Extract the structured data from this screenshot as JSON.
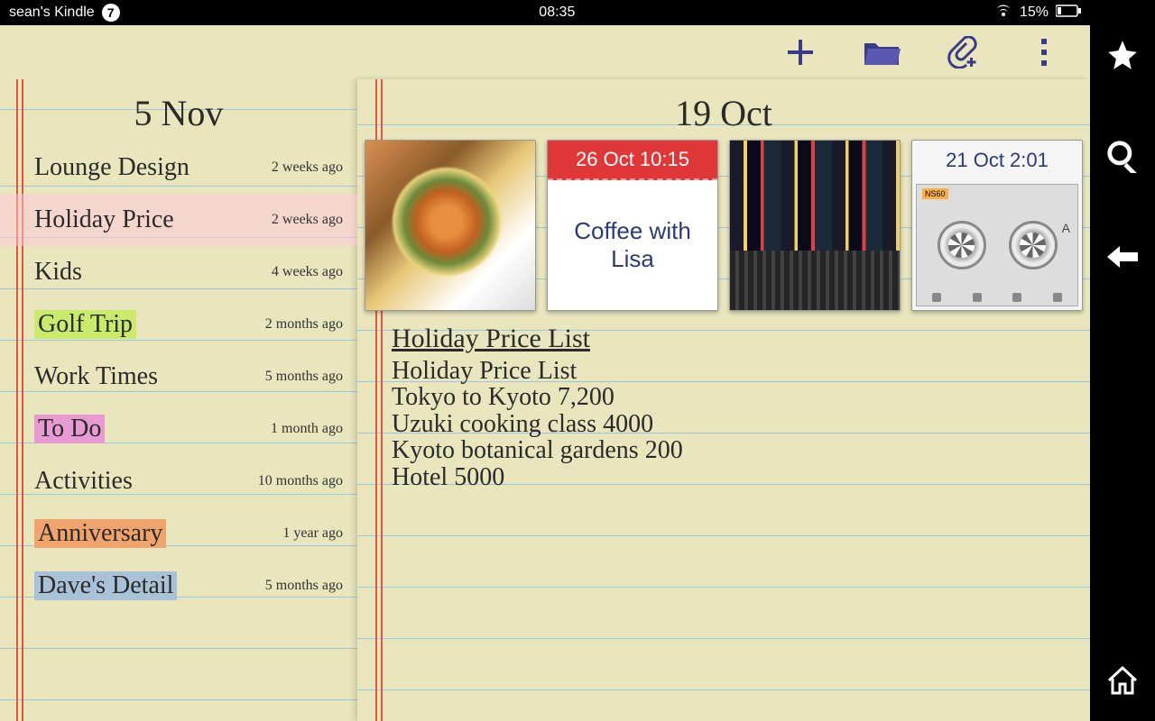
{
  "status": {
    "device": "sean's Kindle",
    "badge": "7",
    "time": "08:35",
    "battery_pct": "15%"
  },
  "sidebar": {
    "date": "5 Nov",
    "items": [
      {
        "title": "Lounge Design",
        "time": "2 weeks ago",
        "highlight": "",
        "selected": false
      },
      {
        "title": "Holiday Price",
        "time": "2 weeks ago",
        "highlight": "",
        "selected": true
      },
      {
        "title": "Kids",
        "time": "4 weeks ago",
        "highlight": "",
        "selected": false
      },
      {
        "title": "Golf Trip",
        "time": "2 months ago",
        "highlight": "green",
        "selected": false
      },
      {
        "title": "Work Times",
        "time": "5 months ago",
        "highlight": "",
        "selected": false
      },
      {
        "title": "To Do",
        "time": "1 month ago",
        "highlight": "pink",
        "selected": false
      },
      {
        "title": "Activities",
        "time": "10 months ago",
        "highlight": "",
        "selected": false
      },
      {
        "title": "Anniversary",
        "time": "1 year ago",
        "highlight": "orange",
        "selected": false
      },
      {
        "title": "Dave's Detail",
        "time": "5 months ago",
        "highlight": "blue",
        "selected": false
      }
    ]
  },
  "detail": {
    "date": "19 Oct",
    "thumbs": {
      "food": {
        "alt": "sushi plate"
      },
      "calendar": {
        "header": "26 Oct 10:15",
        "body": "Coffee with Lisa"
      },
      "city": {
        "alt": "city night street"
      },
      "audio": {
        "header": "21 Oct 2:01",
        "cassette_label": "NS60",
        "side": "A"
      }
    },
    "note": {
      "title": "Holiday Price List",
      "lines": [
        "Holiday Price List",
        "Tokyo to Kyoto 7,200",
        "Uzuki cooking class 4000",
        "Kyoto botanical gardens 200",
        "Hotel 5000"
      ]
    }
  }
}
